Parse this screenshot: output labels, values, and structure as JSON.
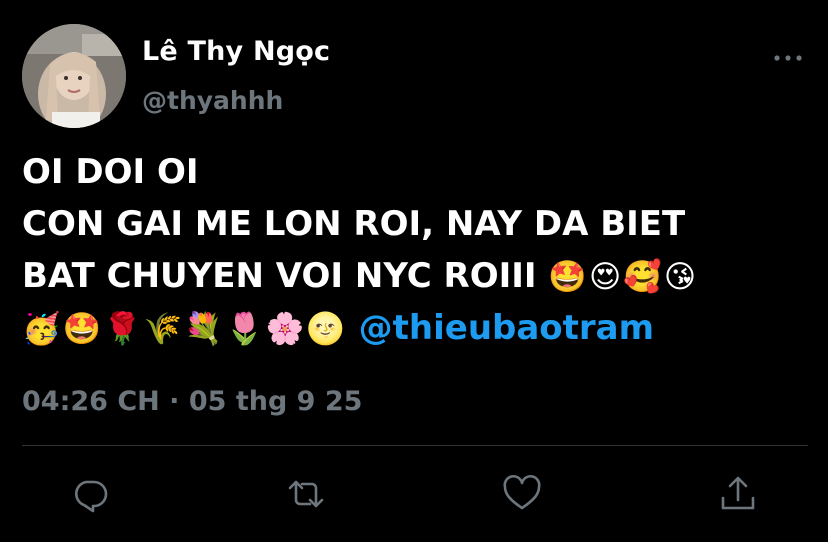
{
  "author": {
    "name": "Lê Thy Ngọc",
    "handle": "@thyahhh"
  },
  "tweet": {
    "line1": "OI DOI OI",
    "line2": "CON GAI ME LON ROI, NAY DA BIET",
    "line3_text": "BAT CHUYEN VOI NYC ROIII",
    "line3_emojis": "🤩😍🥰😘",
    "line4_emojis": "🥳🤩🌹🌾💐🌷🌸🌝",
    "mention": "@thieubaotram"
  },
  "meta": {
    "time": "04:26 CH",
    "separator": "·",
    "date": "05 thg 9 25"
  },
  "icons": {
    "more": "more-dots-icon",
    "reply": "reply-icon",
    "retweet": "retweet-icon",
    "like": "heart-icon",
    "share": "share-icon"
  },
  "colors": {
    "background": "#000000",
    "text": "#ffffff",
    "secondary": "#6e767d",
    "link": "#1d9bf0",
    "divider": "#2f3336"
  }
}
